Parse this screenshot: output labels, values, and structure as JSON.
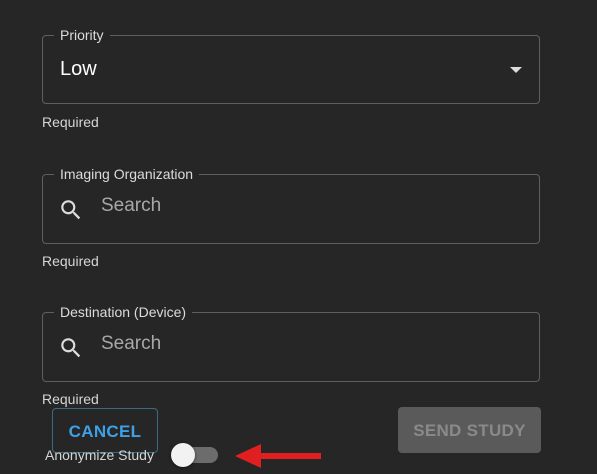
{
  "priority": {
    "label": "Priority",
    "value": "Low",
    "helper": "Required"
  },
  "organization": {
    "label": "Imaging Organization",
    "placeholder": "Search",
    "helper": "Required"
  },
  "destination": {
    "label": "Destination (Device)",
    "placeholder": "Search",
    "helper": "Required"
  },
  "actions": {
    "cancel_label": "CANCEL",
    "send_label": "SEND STUDY",
    "send_enabled": false
  },
  "anonymize": {
    "label": "Anonymize Study",
    "checked": false
  },
  "icons": {
    "search": "search-icon",
    "caret": "chevron-down-icon",
    "arrow": "arrow-left-icon"
  },
  "colors": {
    "accent": "#3fa0e6",
    "annotation_arrow": "#e02020"
  }
}
